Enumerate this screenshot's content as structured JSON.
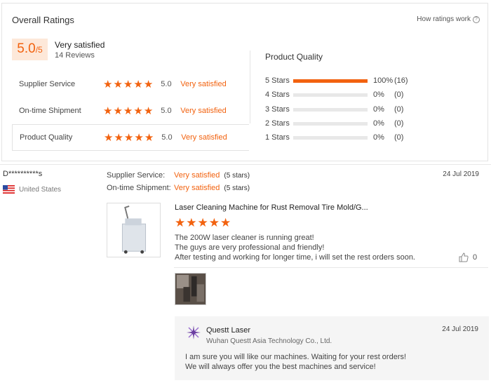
{
  "overall": {
    "title": "Overall Ratings",
    "how_link": "How ratings work",
    "score": "5.0",
    "score_max": "/5",
    "verdict": "Very satisfied",
    "reviews": "14 Reviews"
  },
  "categories": [
    {
      "label": "Supplier Service",
      "score": "5.0",
      "verdict": "Very satisfied",
      "stars": 5
    },
    {
      "label": "On-time Shipment",
      "score": "5.0",
      "verdict": "Very satisfied",
      "stars": 5
    },
    {
      "label": "Product Quality",
      "score": "5.0",
      "verdict": "Very satisfied",
      "stars": 5
    }
  ],
  "breakdown": {
    "title": "Product Quality",
    "rows": [
      {
        "label": "5 Stars",
        "fill": 1.0,
        "pct": "100%",
        "count": "(16)"
      },
      {
        "label": "4 Stars",
        "fill": 0,
        "pct": "0%",
        "count": "(0)"
      },
      {
        "label": "3 Stars",
        "fill": 0,
        "pct": "0%",
        "count": "(0)"
      },
      {
        "label": "2 Stars",
        "fill": 0,
        "pct": "0%",
        "count": "(0)"
      },
      {
        "label": "1 Stars",
        "fill": 0,
        "pct": "0%",
        "count": "(0)"
      }
    ]
  },
  "review": {
    "user": "D**********s",
    "country": "United States",
    "date": "24 Jul 2019",
    "supplier_label": "Supplier Service:",
    "supplier_value": "Very satisfied",
    "supplier_stars": "(5 stars)",
    "shipment_label": "On-time Shipment:",
    "shipment_value": "Very satisfied",
    "shipment_stars": "(5 stars)",
    "product": "Laser Cleaning Machine for Rust Removal Tire Mold/G...",
    "rating": 5,
    "text": [
      "The 200W laser cleaner is running great!",
      "The guys are very professional and friendly!",
      "After testing and working for longer time, i will set the rest orders soon."
    ],
    "likes": "0"
  },
  "reply": {
    "name": "Questt Laser",
    "company": "Wuhan Questt Asia Technology Co., Ltd.",
    "date": "24 Jul 2019",
    "text": [
      "I am sure you will like our machines. Waiting for your rest orders!",
      "We will always offer you the best machines and service!"
    ]
  },
  "colors": {
    "accent": "#f2620f",
    "accent_bg": "#fde8d9"
  }
}
